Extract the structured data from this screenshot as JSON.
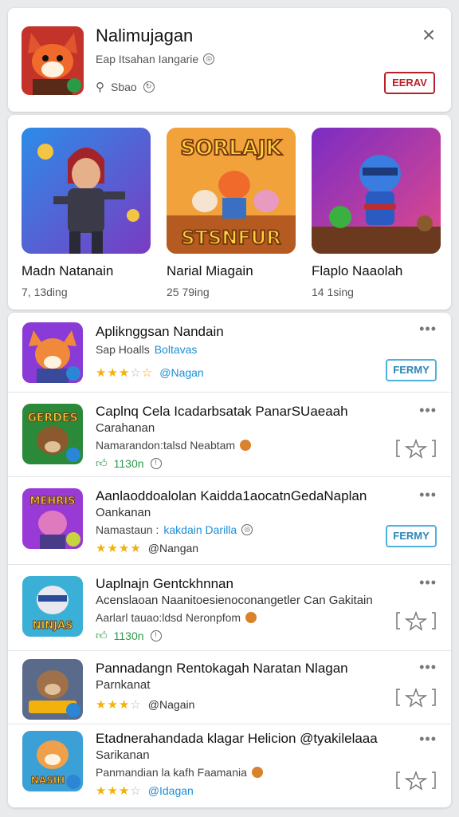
{
  "header": {
    "title": "Nalimujagan",
    "subtitle": "Eap Itsahan Iangarie",
    "meta": "Sbao",
    "button": "EERAV",
    "close": "×"
  },
  "featured": [
    {
      "name": "Madn Natanain",
      "count": "7, 13ding"
    },
    {
      "name": "Narial Miagain",
      "count": "25 79ing"
    },
    {
      "name": "Flaplo Naaolah",
      "count": "14 1sing"
    }
  ],
  "apps": [
    {
      "title": "Apliknggsan Nandain",
      "sub": "Sap Hoalls",
      "sub_blue": "Boltavas",
      "rating_filled": 3,
      "rating_text": "@Nagan",
      "button": "FERMY"
    },
    {
      "title": "Caplnq Cela Icadarbsatak PanarSUaeaah",
      "sub": "Carahanan",
      "desc": "Namarandon:talsd Neabtam",
      "meta": "1130n"
    },
    {
      "title": "Aanlaoddoalolan Kaidda1aocatnGedaNaplan",
      "sub": "Oankanan",
      "desc": "Namastaun :",
      "desc_blue": "kakdain Darilla",
      "rating_filled": 4,
      "rating_text": "@Nangan",
      "button": "FERMY"
    },
    {
      "title": "Uaplnajn Gentckhnnan",
      "sub": "Acenslaoan Naanitoesienoconangetler Can Gakitain",
      "desc": "Aarlarl tauao:ldsd Neronpfom",
      "meta": "1130n"
    },
    {
      "title": "Pannadangn Rentokagah Naratan Nlagan",
      "sub": "Parnkanat",
      "rating_filled": 3,
      "rating_text": "@Nagain"
    },
    {
      "title": "Etadnerahandada klagar Helicion @tyakilelaaa",
      "sub": "Sarikanan",
      "desc": "Panmandian la kafh Faamania",
      "rating_filled": 3,
      "rating_text": "@Idagan"
    }
  ]
}
